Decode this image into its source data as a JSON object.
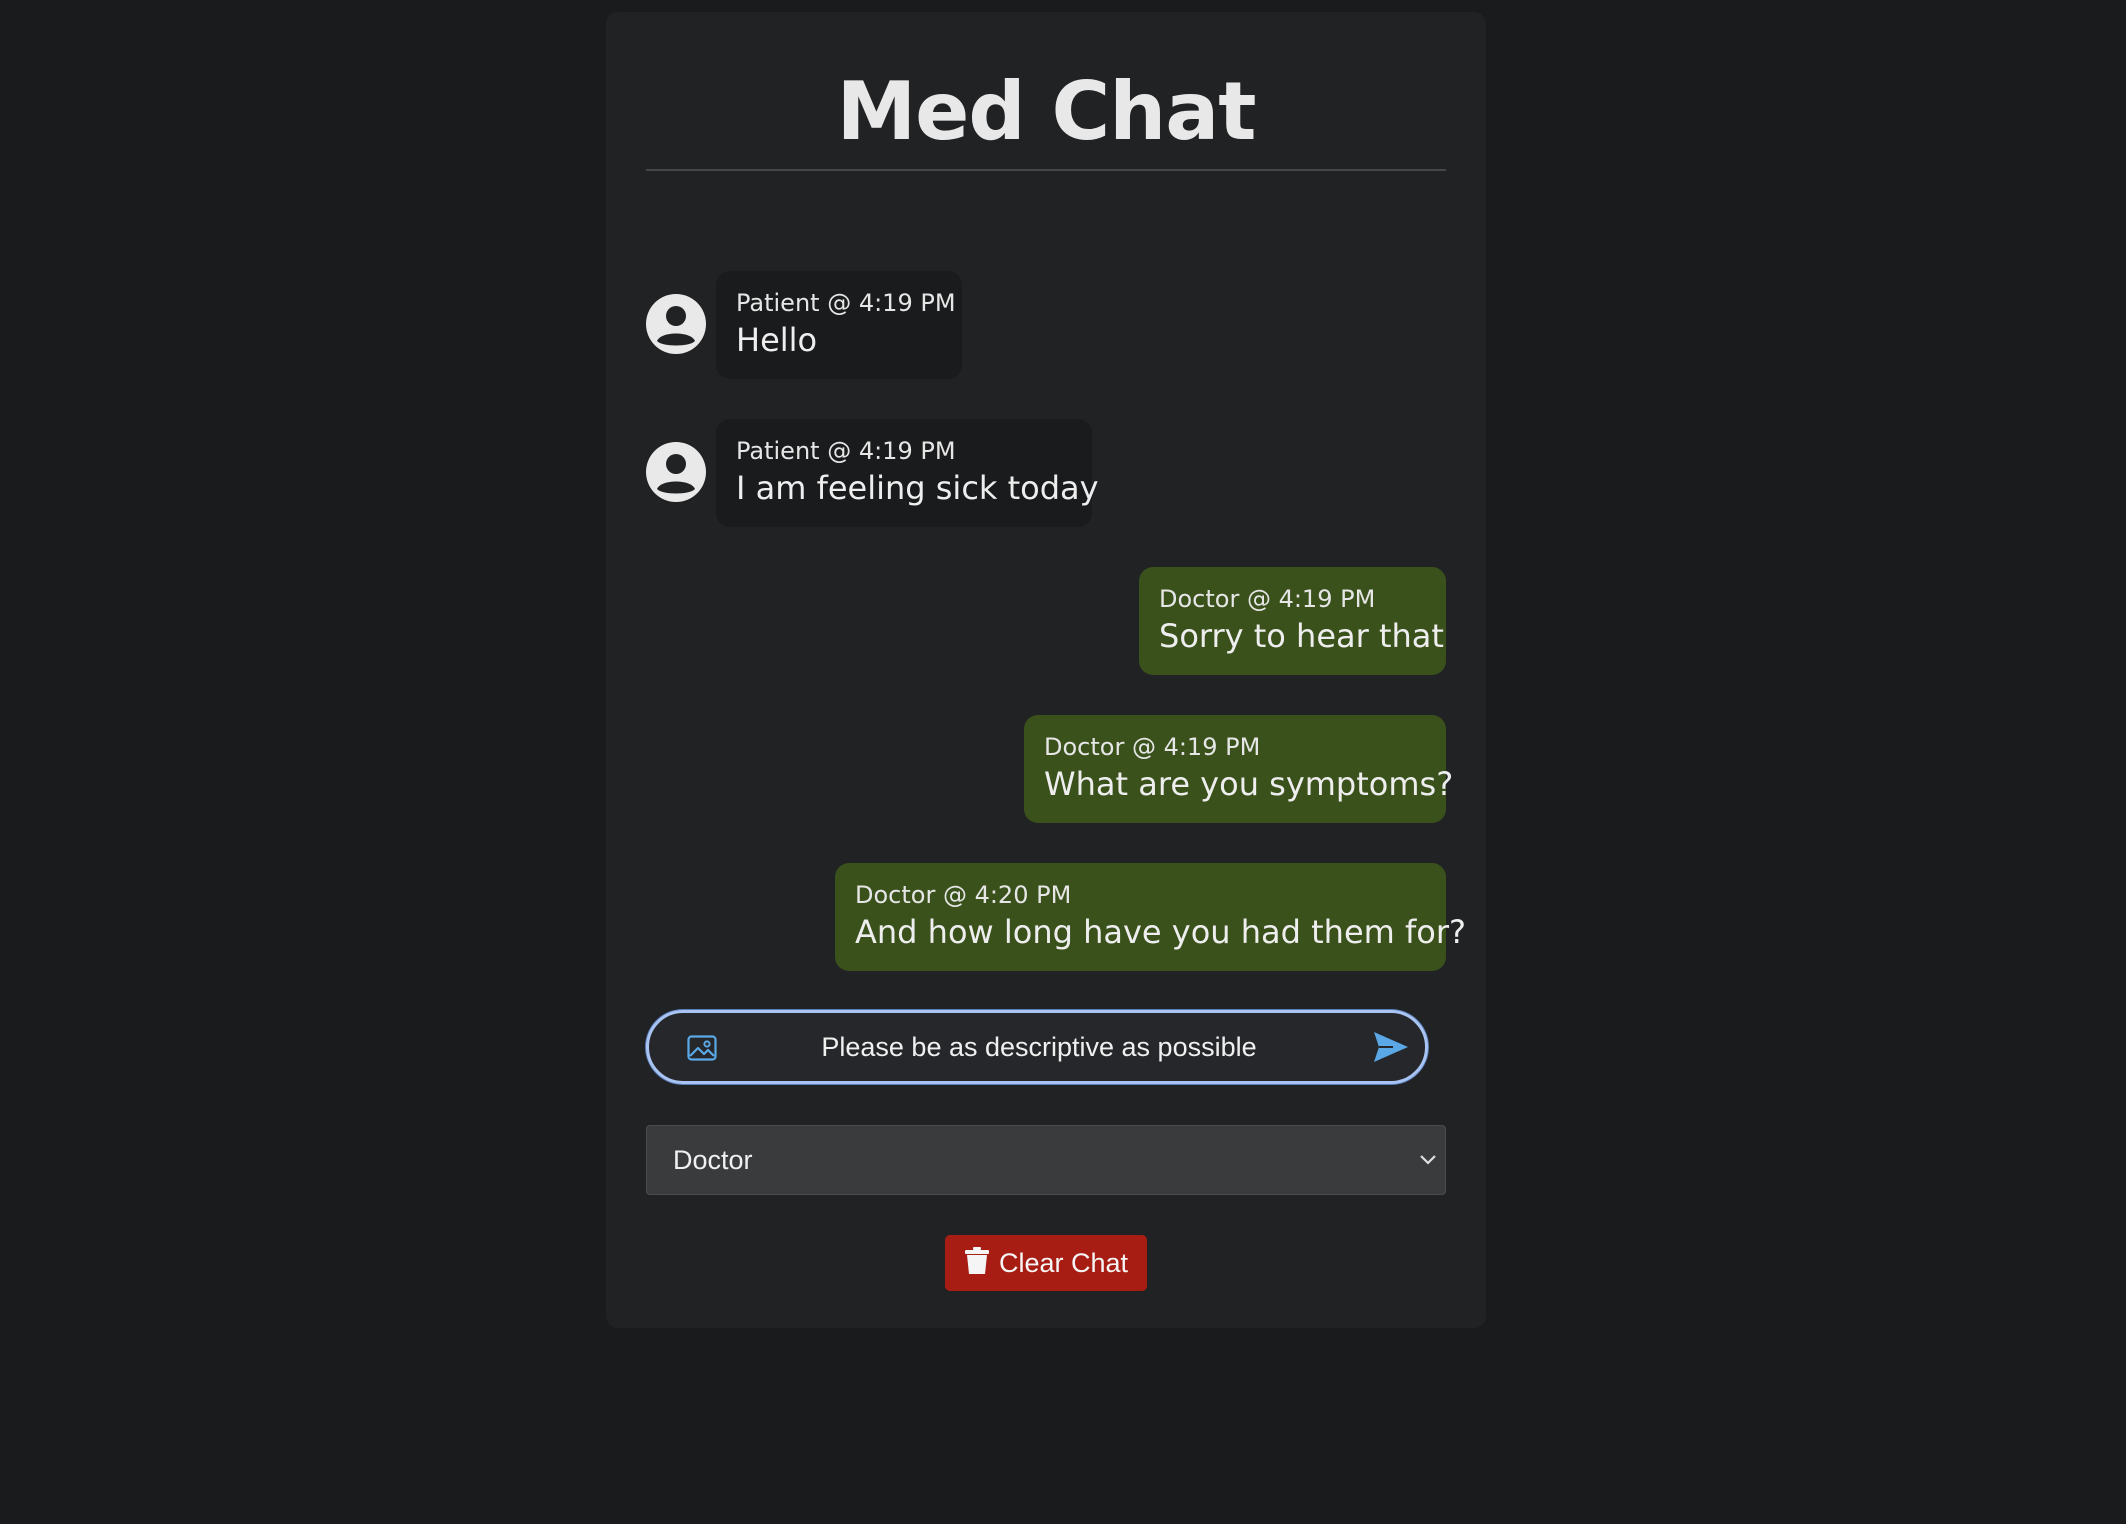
{
  "app": {
    "title": "Med Chat"
  },
  "messages": [
    {
      "role": "patient",
      "meta": "Patient @ 4:19 PM",
      "text": "Hello"
    },
    {
      "role": "patient",
      "meta": "Patient @ 4:19 PM",
      "text": "I am feeling sick today"
    },
    {
      "role": "doctor",
      "meta": "Doctor @ 4:19 PM",
      "text": "Sorry to hear that"
    },
    {
      "role": "doctor",
      "meta": "Doctor @ 4:19 PM",
      "text": "What are you symptoms?"
    },
    {
      "role": "doctor",
      "meta": "Doctor @ 4:20 PM",
      "text": "And how long have you had them for?"
    }
  ],
  "composer": {
    "value": "Please be as descriptive as possible",
    "attach_icon": "image-icon",
    "send_icon": "send-icon"
  },
  "role_select": {
    "selected": "Doctor"
  },
  "clear_button": {
    "label": "Clear Chat",
    "icon": "trash-icon"
  },
  "colors": {
    "background": "#1a1b1d",
    "panel": "#212224",
    "patient_bubble": "#1a1b1c",
    "doctor_bubble": "#3a511b",
    "accent": "#5aa9e6",
    "danger": "#a81d13"
  }
}
